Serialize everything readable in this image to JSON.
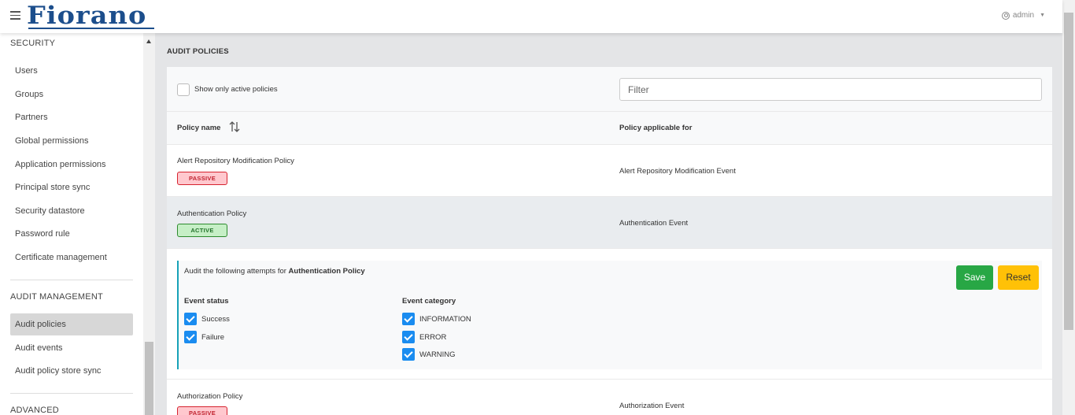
{
  "header": {
    "logo": "Fiorano",
    "user": "admin"
  },
  "sidebar": {
    "sections": [
      {
        "title": "SECURITY"
      },
      {
        "title": "AUDIT MANAGEMENT"
      },
      {
        "title": "ADVANCED"
      }
    ],
    "security_items": [
      "Users",
      "Groups",
      "Partners",
      "Global permissions",
      "Application permissions",
      "Principal store sync",
      "Security datastore",
      "Password rule",
      "Certificate management"
    ],
    "audit_items": [
      "Audit policies",
      "Audit events",
      "Audit policy store sync"
    ],
    "active_item": "Audit policies"
  },
  "page": {
    "title": "AUDIT POLICIES"
  },
  "toolbar": {
    "show_active_label": "Show only active policies",
    "filter_placeholder": "Filter"
  },
  "table": {
    "col_name": "Policy name",
    "col_applicable": "Policy applicable for",
    "rows": [
      {
        "name": "Alert Repository Modification Policy",
        "status": "PASSIVE",
        "applicable": "Alert Repository Modification Event"
      },
      {
        "name": "Authentication Policy",
        "status": "ACTIVE",
        "applicable": "Authentication Event"
      },
      {
        "name": "Authorization Policy",
        "status": "PASSIVE",
        "applicable": "Authorization Event"
      }
    ]
  },
  "detail": {
    "prefix": "Audit the following attempts for",
    "policy": "Authentication Policy",
    "save_label": "Save",
    "reset_label": "Reset",
    "event_status_title": "Event status",
    "event_status": [
      {
        "label": "Success",
        "checked": true
      },
      {
        "label": "Failure",
        "checked": true
      }
    ],
    "event_category_title": "Event category",
    "event_category": [
      {
        "label": "INFORMATION",
        "checked": true
      },
      {
        "label": "ERROR",
        "checked": true
      },
      {
        "label": "WARNING",
        "checked": true
      }
    ]
  },
  "colors": {
    "accent": "#17a2b8",
    "save": "#28a745",
    "reset": "#ffc107",
    "checkbox": "#1a8cf0",
    "logo": "#1c4e8c"
  }
}
